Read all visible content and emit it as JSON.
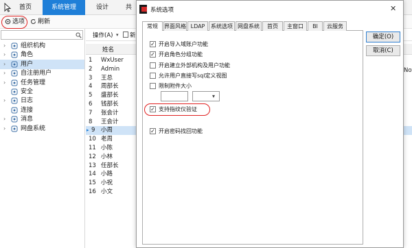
{
  "menubar": {
    "items": [
      "首页",
      "系统管理",
      "设计",
      "共"
    ],
    "active_index": 1
  },
  "toolbar": {
    "options_label": "选项",
    "refresh_label": "刷新"
  },
  "left_nav": {
    "search_value": "",
    "items": [
      {
        "label": "组织机构",
        "icon": "org-icon",
        "expandable": true
      },
      {
        "label": "角色",
        "icon": "role-icon",
        "expandable": true
      },
      {
        "label": "用户",
        "icon": "user-icon",
        "expandable": true,
        "selected": true
      },
      {
        "label": "自注册用户",
        "icon": "self-register-icon",
        "expandable": true
      },
      {
        "label": "任务管理",
        "icon": "task-icon",
        "expandable": true
      },
      {
        "label": "安全",
        "icon": "shield-icon",
        "expandable": false
      },
      {
        "label": "日志",
        "icon": "log-icon",
        "expandable": true
      },
      {
        "label": "连接",
        "icon": "connection-icon",
        "expandable": false
      },
      {
        "label": "消息",
        "icon": "message-icon",
        "expandable": true
      },
      {
        "label": "网盘系统",
        "icon": "cloud-drive-icon",
        "expandable": true
      }
    ]
  },
  "list": {
    "toolbar_operate": "操作(A)",
    "toolbar_new": "新建",
    "column_name": "姓名",
    "truncated_right": "Not",
    "rows": [
      {
        "num": "1",
        "name": "WxUser"
      },
      {
        "num": "2",
        "name": "Admin"
      },
      {
        "num": "3",
        "name": "王总"
      },
      {
        "num": "4",
        "name": "周部长"
      },
      {
        "num": "5",
        "name": "盛部长"
      },
      {
        "num": "6",
        "name": "钱部长"
      },
      {
        "num": "7",
        "name": "张会计"
      },
      {
        "num": "8",
        "name": "王会计"
      },
      {
        "num": "9",
        "name": "小周",
        "selected": true
      },
      {
        "num": "10",
        "name": "老周"
      },
      {
        "num": "11",
        "name": "小陈"
      },
      {
        "num": "12",
        "name": "小林"
      },
      {
        "num": "13",
        "name": "任部长"
      },
      {
        "num": "14",
        "name": "小路"
      },
      {
        "num": "15",
        "name": "小祝"
      },
      {
        "num": "16",
        "name": "小文"
      }
    ]
  },
  "dialog": {
    "title": "系统选项",
    "close_symbol": "✕",
    "tabs": [
      "常规",
      "界面风格",
      "LDAP",
      "系统选项",
      "网盘系统",
      "首页",
      "主窗口",
      "BI",
      "云服务"
    ],
    "active_tab": 0,
    "ok_label": "确定(O)",
    "cancel_label": "取消(C)",
    "options": [
      {
        "label": "开启导入域账户功能",
        "checked": true
      },
      {
        "label": "开启角色分组功能",
        "checked": true
      },
      {
        "label": "开启建立外部机构及用户功能",
        "checked": false
      },
      {
        "label": "允许用户直接写sql定义视图",
        "checked": false
      },
      {
        "label": "限制附件大小",
        "checked": false
      }
    ],
    "fingerprint_option": {
      "label": "支持指纹仪验证",
      "checked": true
    },
    "password_option": {
      "label": "开启密码找回功能",
      "checked": true
    },
    "size_value": "",
    "size_unit": ""
  },
  "colors": {
    "accent": "#1f7fd8",
    "selection": "#cfe3f7",
    "highlight_ring": "#e02020"
  }
}
